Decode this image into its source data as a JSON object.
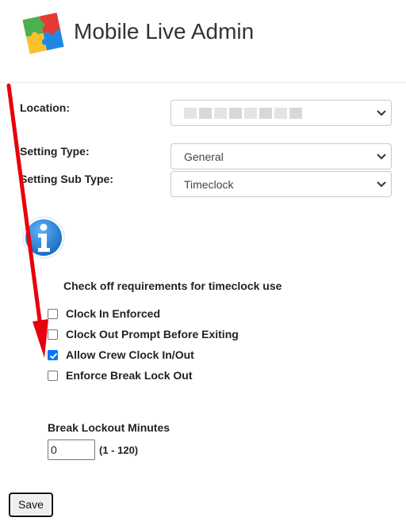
{
  "app": {
    "title": "Mobile Live Admin"
  },
  "form": {
    "location_label": "Location:",
    "setting_type_label": "Setting Type:",
    "setting_type_value": "General",
    "setting_sub_type_label": "Setting Sub Type:",
    "setting_sub_type_value": "Timeclock"
  },
  "requirements": {
    "heading": "Check off requirements for timeclock use",
    "items": [
      {
        "label": "Clock In Enforced",
        "checked": false
      },
      {
        "label": "Clock Out Prompt Before Exiting",
        "checked": false
      },
      {
        "label": "Allow Crew Clock In/Out",
        "checked": true
      },
      {
        "label": "Enforce Break Lock Out",
        "checked": false
      }
    ]
  },
  "break_lockout": {
    "label": "Break Lockout Minutes",
    "value": "0",
    "range_hint": "(1 - 120)"
  },
  "actions": {
    "save_label": "Save"
  },
  "colors": {
    "checkbox_checked": "#0075ff",
    "annotation_arrow": "#e8000b",
    "info_icon": "#1a7ad4"
  }
}
